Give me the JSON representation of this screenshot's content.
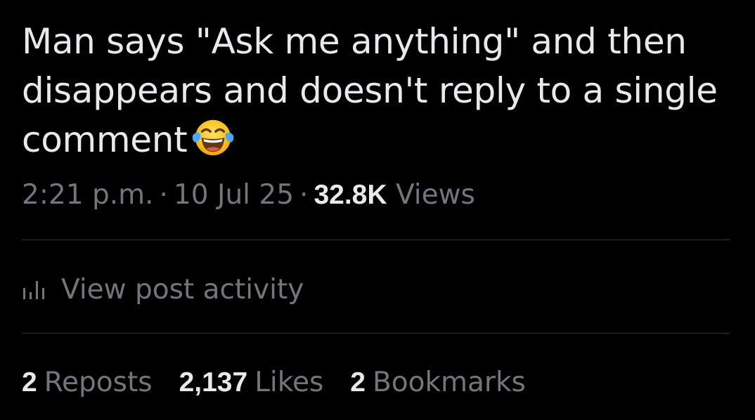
{
  "tweet": {
    "text": "Man says \"Ask me anything\" and then disappears and doesn't reply to a single comment",
    "emoji": "face-with-tears-of-joy"
  },
  "meta": {
    "time": "2:21 p.m.",
    "separator": "·",
    "date": "10 Jul 25",
    "views_count": "32.8K",
    "views_label": "Views"
  },
  "activity": {
    "label": "View post activity",
    "icon": "analytics-bars-icon"
  },
  "stats": [
    {
      "count": "2",
      "label": "Reposts"
    },
    {
      "count": "2,137",
      "label": "Likes"
    },
    {
      "count": "2",
      "label": "Bookmarks"
    }
  ],
  "colors": {
    "background": "#000000",
    "primary_text": "#e7e9ea",
    "secondary_text": "#71767b",
    "divider": "#2f3336"
  }
}
